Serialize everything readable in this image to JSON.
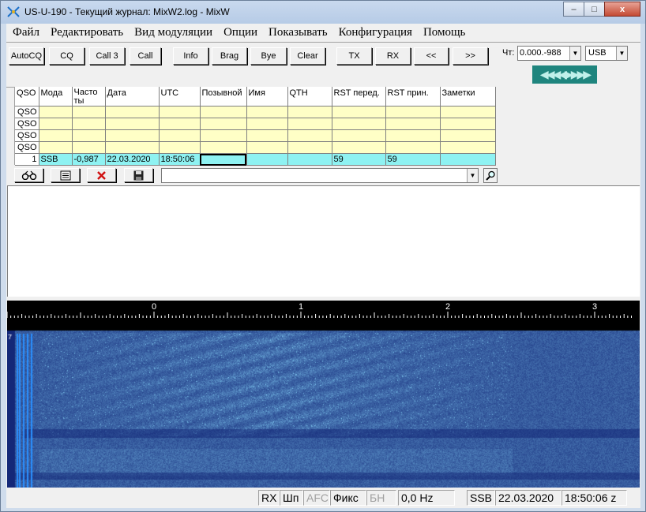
{
  "window": {
    "title": "US-U-190 - Текущий журнал: MixW2.log - MixW",
    "controls": {
      "minimize": "–",
      "maximize": "□",
      "close": "x"
    }
  },
  "menu": [
    "Файл",
    "Редактировать",
    "Вид модуляции",
    "Опции",
    "Показывать",
    "Конфигурация",
    "Помощь"
  ],
  "toolbar": {
    "buttons": [
      "AutoCQ",
      "CQ",
      "Call 3",
      "Call",
      "Info",
      "Brag",
      "Bye",
      "Clear",
      "TX",
      "RX",
      "<<",
      ">>"
    ]
  },
  "rig": {
    "freq_label": "Чт:",
    "freq_value": "0.000.-988",
    "mode_value": "USB",
    "arrows": "◀◀◀◀▶▶▶▶"
  },
  "log": {
    "columns": [
      "QSO",
      "Мода",
      "Часто ты",
      "Дата",
      "UTC",
      "Позывной",
      "Имя",
      "QTH",
      "RST перед.",
      "RST прин.",
      "Заметки"
    ],
    "empty_row_label": "QSO",
    "current_row": {
      "num": "1",
      "mode": "SSB",
      "freq": "-0,987",
      "date": "22.03.2020",
      "utc": "18:50:06",
      "call": "",
      "name": "",
      "qth": "",
      "rst_sent": "59",
      "rst_rcvd": "59",
      "notes": ""
    }
  },
  "icons": {
    "binoculars": "binoculars-icon",
    "list": "list-icon",
    "delete": "delete-icon",
    "save": "save-icon",
    "search": "search-icon"
  },
  "waterfall": {
    "scale_labels": [
      "0",
      "1",
      "2",
      "3"
    ],
    "left_marker": "7"
  },
  "status": {
    "rx": "RX",
    "squelch": "Шп",
    "afc": "AFC",
    "fix": "Фикс",
    "bn": "БН",
    "offset": "0,0 Hz",
    "mode": "SSB",
    "date": "22.03.2020",
    "time": "18:50:06 z"
  }
}
